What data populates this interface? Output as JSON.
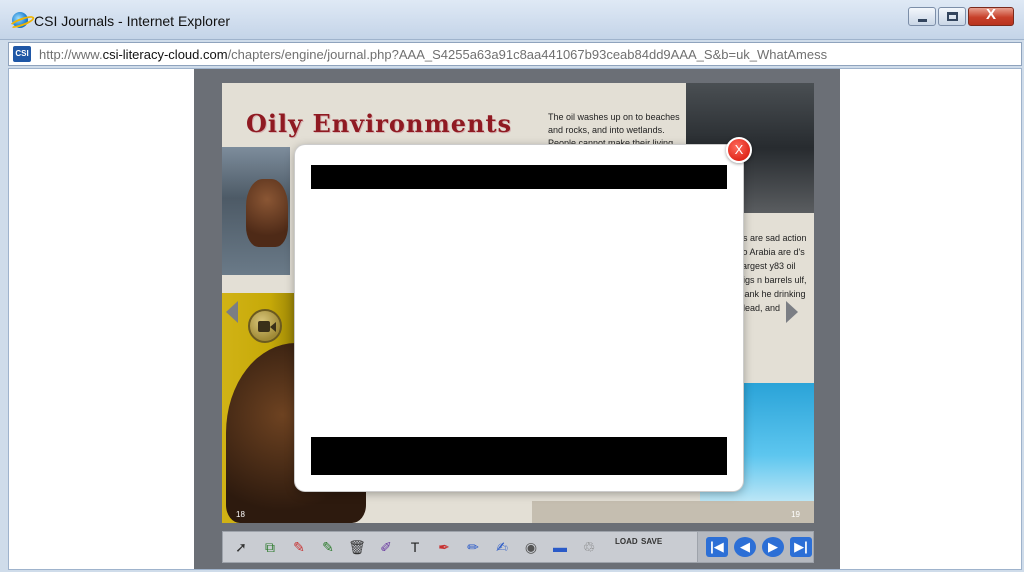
{
  "window": {
    "title": "CSI Journals - Internet Explorer",
    "url_prefix": "http://www.",
    "url_host": "csi-literacy-cloud.com",
    "url_path": "/chapters/engine/journal.php?AAA_S4255a63a91c8aa441067b93ceab84dd9AAA_S&b=uk_WhatAmess",
    "logo_text": "CSI",
    "buttons": {
      "minimize": "",
      "maximize": "",
      "close": "X"
    }
  },
  "page": {
    "title": "Oily Environments",
    "blurb": "The oil washes up on to beaches and rocks, and into wetlands. People cannot make their living",
    "right_text": "rs are sad action to Arabia are d's largest y83 oil rigs n barrels ulf, sank he drinking dead, and",
    "page_left_num": "18",
    "page_right_num": "19"
  },
  "modal": {
    "close_label": "X"
  },
  "toolbar": {
    "tools": [
      {
        "name": "pointer-tool-icon",
        "glyph": "➚"
      },
      {
        "name": "add-bookmark-icon",
        "glyph": "⧉"
      },
      {
        "name": "highlight-icon",
        "glyph": "✎"
      },
      {
        "name": "remove-highlight-icon",
        "glyph": "✎"
      },
      {
        "name": "trash-icon",
        "glyph": "🗑"
      },
      {
        "name": "eraser-icon",
        "glyph": "✐"
      },
      {
        "name": "text-tool-icon",
        "glyph": "T"
      },
      {
        "name": "pen-red-icon",
        "glyph": "✒"
      },
      {
        "name": "pen-blue-icon",
        "glyph": "✏"
      },
      {
        "name": "edit-note-icon",
        "glyph": "✍"
      },
      {
        "name": "palette-icon",
        "glyph": "◉"
      },
      {
        "name": "shape-icon",
        "glyph": "▬"
      },
      {
        "name": "stamp-icon",
        "glyph": "♲"
      }
    ],
    "load_label": "LOAD",
    "save_label": "SAVE",
    "nav": {
      "first": "|◀",
      "prev": "◀",
      "next": "▶",
      "last": "▶|"
    }
  }
}
